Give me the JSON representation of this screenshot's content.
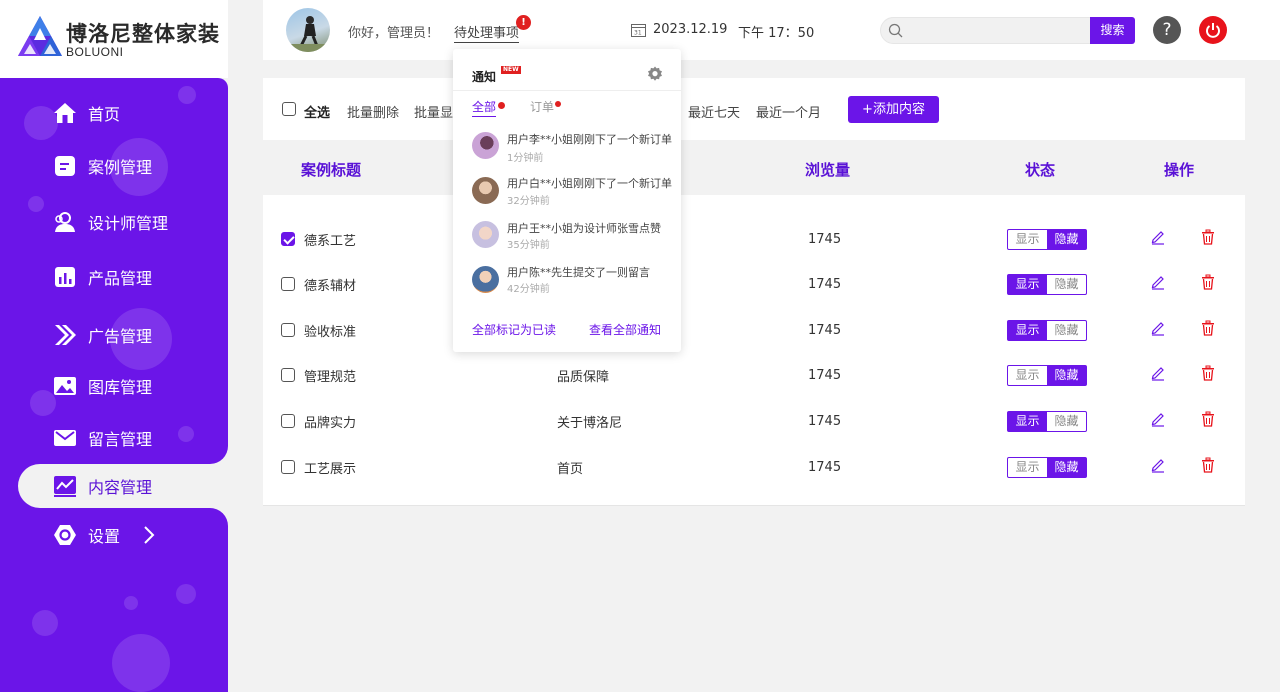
{
  "brand": {
    "name": "博洛尼整体家装",
    "sub": "BOLUONI"
  },
  "sidebar": {
    "items": [
      {
        "label": "首页",
        "icon": "home-icon"
      },
      {
        "label": "案例管理",
        "icon": "document-icon"
      },
      {
        "label": "设计师管理",
        "icon": "user-icon"
      },
      {
        "label": "产品管理",
        "icon": "bar-chart-icon"
      },
      {
        "label": "广告管理",
        "icon": "chevrons-icon"
      },
      {
        "label": "图库管理",
        "icon": "image-icon"
      },
      {
        "label": "留言管理",
        "icon": "mail-icon"
      },
      {
        "label": "内容管理",
        "icon": "line-chart-icon",
        "active": true
      },
      {
        "label": "设置",
        "icon": "hexagon-settings-icon"
      }
    ]
  },
  "header": {
    "greeting": "你好，管理员！",
    "pending_label": "待处理事项",
    "pending_badge": "!",
    "date": "2023.12.19",
    "time": "下午 17：50",
    "search_placeholder": "",
    "search_button": "搜索",
    "help_label": "?"
  },
  "toolbar": {
    "select_all": "全选",
    "batch_delete": "批量删除",
    "batch_show": "批量显",
    "last_seven_days": "最近七天",
    "last_month": "最近一个月",
    "add_button": "+添加内容"
  },
  "table": {
    "headers": {
      "title": "案例标题",
      "views": "浏览量",
      "status": "状态",
      "actions": "操作"
    },
    "toggle_labels": {
      "show": "显示",
      "hide": "隐藏"
    },
    "rows": [
      {
        "title": "德系工艺",
        "category": "",
        "views": "1745",
        "checked": true,
        "status": "hide"
      },
      {
        "title": "德系辅材",
        "category": "",
        "views": "1745",
        "checked": false,
        "status": "show"
      },
      {
        "title": "验收标准",
        "category": "",
        "views": "1745",
        "checked": false,
        "status": "show"
      },
      {
        "title": "管理规范",
        "category": "品质保障",
        "views": "1745",
        "checked": false,
        "status": "hide"
      },
      {
        "title": "品牌实力",
        "category": "关于博洛尼",
        "views": "1745",
        "checked": false,
        "status": "show"
      },
      {
        "title": "工艺展示",
        "category": "首页",
        "views": "1745",
        "checked": false,
        "status": "hide"
      }
    ]
  },
  "notifications": {
    "title": "通知",
    "new_tag": "NEW",
    "tabs": {
      "all": "全部",
      "orders": "订单"
    },
    "items": [
      {
        "text": "用户李**小姐刚刚下了一个新订单",
        "time": "1分钟前"
      },
      {
        "text": "用户白**小姐刚刚下了一个新订单",
        "time": "32分钟前"
      },
      {
        "text": "用户王**小姐为设计师张雪点赞",
        "time": "35分钟前"
      },
      {
        "text": "用户陈**先生提交了一则留言",
        "time": "42分钟前"
      }
    ],
    "mark_all_read": "全部标记为已读",
    "view_all": "查看全部通知"
  },
  "colors": {
    "accent": "#6b15e8",
    "danger": "#e8131b",
    "background": "#f2f2f2"
  }
}
